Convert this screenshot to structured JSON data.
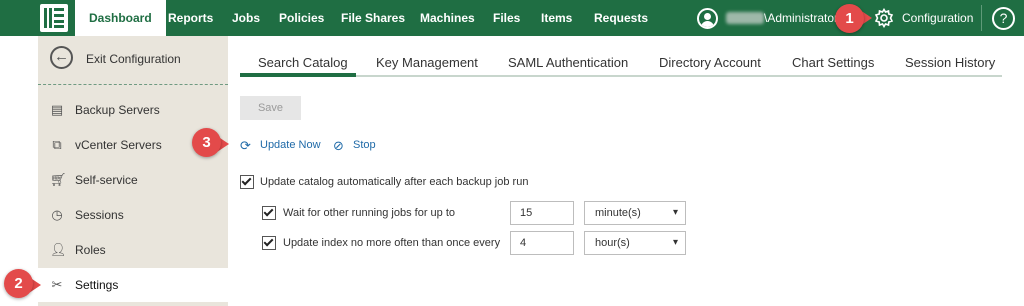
{
  "nav": {
    "items": [
      "Dashboard",
      "Reports",
      "Jobs",
      "Policies",
      "File Shares",
      "Machines",
      "Files",
      "Items",
      "Requests"
    ],
    "user": "\\Administrator",
    "config_label": "Configuration",
    "help_label": "?"
  },
  "sidebar": {
    "exit_label": "Exit Configuration",
    "items": [
      {
        "label": "Backup Servers",
        "icon": "server-icon"
      },
      {
        "label": "vCenter Servers",
        "icon": "vcenter-icon"
      },
      {
        "label": "Self-service",
        "icon": "cart-icon"
      },
      {
        "label": "Sessions",
        "icon": "clock-icon"
      },
      {
        "label": "Roles",
        "icon": "user-icon"
      },
      {
        "label": "Settings",
        "icon": "tools-icon"
      }
    ]
  },
  "tabs": [
    "Search Catalog",
    "Key Management",
    "SAML Authentication",
    "Directory Account",
    "Chart Settings",
    "Session History"
  ],
  "active_tab": "Search Catalog",
  "form": {
    "save_label": "Save",
    "update_now_label": "Update Now",
    "stop_label": "Stop",
    "auto_update_label": "Update catalog automatically after each backup job run",
    "wait_label": "Wait for other running jobs for up to",
    "wait_value": "15",
    "wait_unit": "minute(s)",
    "index_label": "Update index no more often than once every",
    "index_value": "4",
    "index_unit": "hour(s)"
  },
  "badges": [
    "1",
    "2",
    "3"
  ],
  "colors": {
    "brand_green": "#1f6e43",
    "link_blue": "#1f6aa8",
    "badge_red": "#e34a4a",
    "sidebar_bg": "#e9e5dc"
  }
}
